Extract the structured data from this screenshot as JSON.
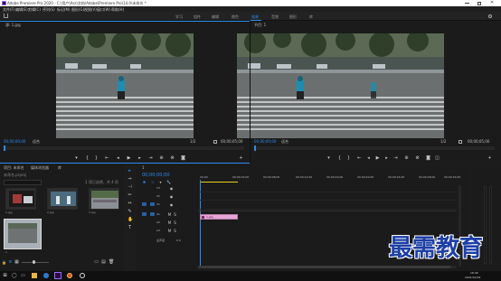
{
  "window": {
    "title": "Adobe Premiere Pro 2020 - C:\\用户\\Ass\\文档\\Adobe\\Premiere Pro\\14.0\\未命名 *"
  },
  "menu": [
    "文件(F)",
    "编辑(E)",
    "剪辑(C)",
    "序列(S)",
    "标记(M)",
    "图形(G)",
    "视图(V)",
    "窗口(W)",
    "帮助(H)"
  ],
  "workspaces": [
    "学习",
    "组件",
    "编辑",
    "颜色",
    "效果",
    "音频",
    "图形",
    "库"
  ],
  "source_monitor": {
    "tab": "源: 1.jpg",
    "timecode_left": "00;00;00;00",
    "fit": "适合",
    "ratio": "1/2",
    "timecode_right": "00;00;05;00"
  },
  "program_monitor": {
    "tab": "节目: 1",
    "timecode_left": "00;00;00;00",
    "fit": "适合",
    "ratio": "1/2",
    "timecode_right": "00;00;05;00"
  },
  "project_panel": {
    "tabs": [
      "项目: 未命名",
      "媒体浏览器",
      "库"
    ],
    "path": "未命名.prproj",
    "search_placeholder": "",
    "item_count": "1 项已选择，共 4 项",
    "items": [
      {
        "label": "1.jpg"
      },
      {
        "label": "2.jpg"
      },
      {
        "label": "3.jpg"
      },
      {
        "label": "1"
      }
    ]
  },
  "timeline": {
    "tab": "1",
    "timecode": "00;00;00;00",
    "ruler": [
      "00;00",
      "00;00;04;00",
      "00;00;08;00",
      "00;00;12;00",
      "00;00;16;00",
      "00;00;20;00",
      "00;00;24;00",
      "00;00;28;00",
      "00;00;32;00"
    ],
    "tracks": [
      {
        "name": "V3"
      },
      {
        "name": "V2"
      },
      {
        "name": "V1"
      },
      {
        "name": "A1"
      },
      {
        "name": "A2"
      },
      {
        "name": "A3"
      },
      {
        "name": "主声道"
      }
    ],
    "master_value": "0.0",
    "clip_label": "1.jpg"
  },
  "watermark": "最需教育",
  "taskbar": {
    "time": "16:40",
    "date": "2021/10/19"
  },
  "colors": {
    "accent_blue": "#2d8ceb",
    "clip_pink": "#e8a5d8",
    "yellow_bar": "#e6d21a",
    "watermark_blue": "#1d3fa6"
  }
}
